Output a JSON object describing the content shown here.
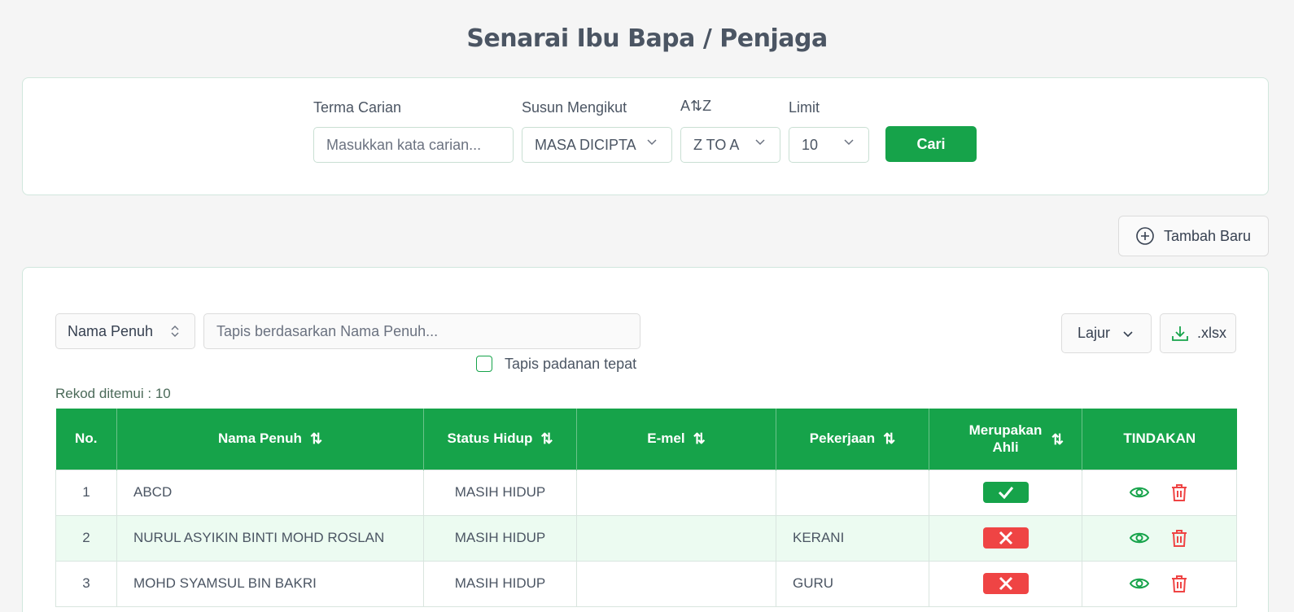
{
  "page": {
    "title": "Senarai Ibu Bapa / Penjaga"
  },
  "search": {
    "term_label": "Terma Carian",
    "term_placeholder": "Masukkan kata carian...",
    "sort_label": "Susun Mengikut",
    "sort_value": "MASA DICIPTA",
    "order_label": "A⇅Z",
    "order_value": "Z TO A",
    "limit_label": "Limit",
    "limit_value": "10",
    "search_button": "Cari"
  },
  "add_button": "Tambah Baru",
  "filter": {
    "column_value": "Nama Penuh",
    "placeholder": "Tapis berdasarkan Nama Penuh...",
    "exact_match_label": "Tapis padanan tepat",
    "exact_match_checked": false,
    "columns_button": "Lajur",
    "export_button": ".xlsx"
  },
  "records_found": "Rekod ditemui : 10",
  "table": {
    "headers": {
      "no": "No.",
      "name": "Nama Penuh",
      "status": "Status Hidup",
      "email": "E-mel",
      "job": "Pekerjaan",
      "member": "Merupakan Ahli",
      "actions": "TINDAKAN"
    },
    "sort_icon": "⇅",
    "rows": [
      {
        "no": "1",
        "name": "ABCD",
        "status": "MASIH HIDUP",
        "email": "",
        "job": "",
        "member": true
      },
      {
        "no": "2",
        "name": "NURUL ASYIKIN BINTI MOHD ROSLAN",
        "status": "MASIH HIDUP",
        "email": "",
        "job": "KERANI",
        "member": false
      },
      {
        "no": "3",
        "name": "MOHD SYAMSUL BIN BAKRI",
        "status": "MASIH HIDUP",
        "email": "",
        "job": "GURU",
        "member": false
      }
    ]
  },
  "colors": {
    "primary": "#16a34a",
    "danger": "#ef4444",
    "row_alt": "#ecfbf1"
  },
  "icons": {
    "add": "plus-circle-icon",
    "export": "download-icon",
    "view": "eye-icon",
    "delete": "trash-icon",
    "yes": "check-icon",
    "no": "x-icon"
  }
}
